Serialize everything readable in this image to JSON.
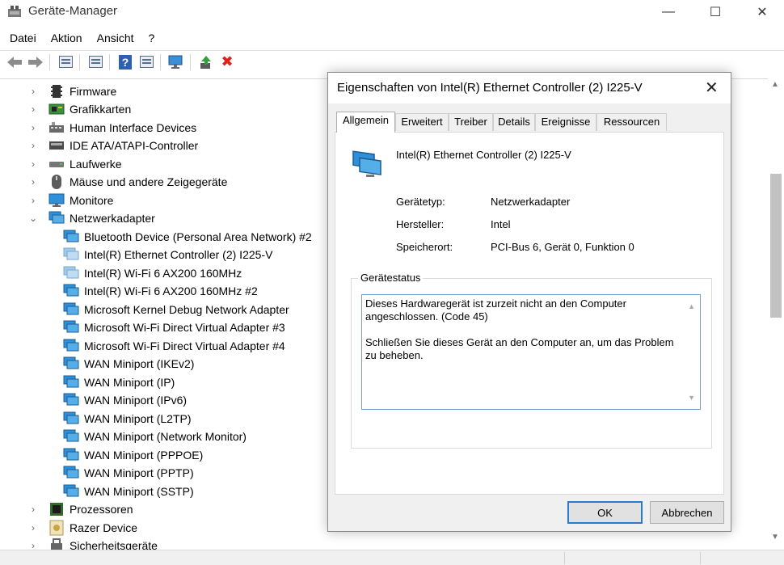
{
  "window": {
    "title": "Geräte-Manager",
    "controls": {
      "minimize": "—",
      "maximize": "☐",
      "close": "✕"
    }
  },
  "menu": [
    "Datei",
    "Aktion",
    "Ansicht",
    "?"
  ],
  "toolbar": {
    "buttons": [
      "back-icon",
      "forward-icon",
      "properties-view-icon",
      "properties-icon",
      "help-icon",
      "update-driver-icon",
      "scan-hardware-icon",
      "enable-device-icon",
      "uninstall-icon"
    ],
    "help_glyph": "?",
    "uninstall_glyph": "✖"
  },
  "tree": {
    "categories_top": [
      {
        "label": "Firmware",
        "expanded": false,
        "icon": "firmware-icon"
      },
      {
        "label": "Grafikkarten",
        "expanded": false,
        "icon": "display-adapter-icon"
      },
      {
        "label": "Human Interface Devices",
        "expanded": false,
        "icon": "hid-icon"
      },
      {
        "label": "IDE ATA/ATAPI-Controller",
        "expanded": false,
        "icon": "ide-controller-icon"
      },
      {
        "label": "Laufwerke",
        "expanded": false,
        "icon": "drive-icon"
      },
      {
        "label": "Mäuse und andere Zeigegeräte",
        "expanded": false,
        "icon": "mouse-icon"
      },
      {
        "label": "Monitore",
        "expanded": false,
        "icon": "monitor-icon"
      },
      {
        "label": "Netzwerkadapter",
        "expanded": true,
        "icon": "network-adapter-icon"
      }
    ],
    "network_children": [
      "Bluetooth Device (Personal Area Network) #2",
      "Intel(R) Ethernet Controller (2) I225-V",
      "Intel(R) Wi-Fi 6 AX200 160MHz",
      "Intel(R) Wi-Fi 6 AX200 160MHz #2",
      "Microsoft Kernel Debug Network Adapter",
      "Microsoft Wi-Fi Direct Virtual Adapter #3",
      "Microsoft Wi-Fi Direct Virtual Adapter #4",
      "WAN Miniport (IKEv2)",
      "WAN Miniport (IP)",
      "WAN Miniport (IPv6)",
      "WAN Miniport (L2TP)",
      "WAN Miniport (Network Monitor)",
      "WAN Miniport (PPPOE)",
      "WAN Miniport (PPTP)",
      "WAN Miniport (SSTP)"
    ],
    "categories_bottom": [
      {
        "label": "Prozessoren",
        "expanded": false,
        "icon": "processor-icon"
      },
      {
        "label": "Razer Device",
        "expanded": false,
        "icon": "razer-device-icon"
      },
      {
        "label": "Sicherheitsgeräte",
        "expanded": false,
        "icon": "security-device-icon"
      }
    ],
    "chevron_collapsed": "›",
    "chevron_expanded": "⌄"
  },
  "dialog": {
    "title": "Eigenschaften von Intel(R) Ethernet Controller (2) I225-V",
    "close": "✕",
    "tabs": [
      "Allgemein",
      "Erweitert",
      "Treiber",
      "Details",
      "Ereignisse",
      "Ressourcen"
    ],
    "active_tab": "Allgemein",
    "device_name": "Intel(R) Ethernet Controller (2) I225-V",
    "properties": {
      "type_label": "Gerätetyp:",
      "type_value": "Netzwerkadapter",
      "manufacturer_label": "Hersteller:",
      "manufacturer_value": "Intel",
      "location_label": "Speicherort:",
      "location_value": "PCI-Bus 6, Gerät 0, Funktion 0"
    },
    "status_group_label": "Gerätestatus",
    "status_line1": "Dieses Hardwaregerät ist zurzeit nicht an den Computer angeschlossen. (Code 45)",
    "status_line2": "Schließen Sie dieses Gerät an den Computer an, um das Problem zu beheben.",
    "ok_label": "OK",
    "cancel_label": "Abbrechen"
  },
  "colors": {
    "accent": "#2a7ad1",
    "uninstall_red": "#e0201a",
    "help_blue": "#2d5fb4",
    "network_icon": "#2f8fd8"
  }
}
